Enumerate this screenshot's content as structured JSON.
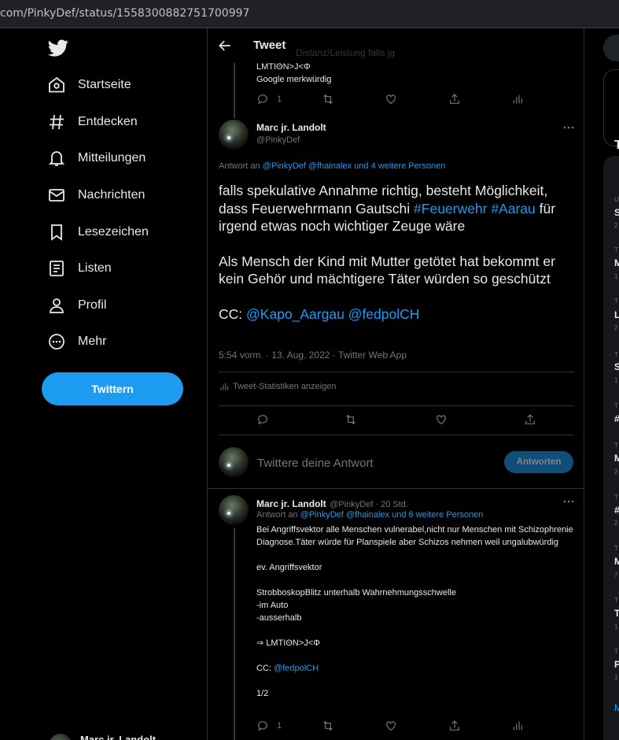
{
  "browser": {
    "url": "com/PinkyDef/status/1558300882751700997"
  },
  "nav": {
    "items": [
      {
        "label": "Startseite",
        "icon": "home-icon"
      },
      {
        "label": "Entdecken",
        "icon": "hashtag-icon"
      },
      {
        "label": "Mitteilungen",
        "icon": "bell-icon"
      },
      {
        "label": "Nachrichten",
        "icon": "mail-icon"
      },
      {
        "label": "Lesezeichen",
        "icon": "bookmark-icon"
      },
      {
        "label": "Listen",
        "icon": "list-icon"
      },
      {
        "label": "Profil",
        "icon": "person-icon"
      },
      {
        "label": "Mehr",
        "icon": "more-circle-icon"
      }
    ],
    "tweet_button": "Twittern",
    "user_name": "Marc jr. Landolt"
  },
  "header": {
    "title": "Tweet",
    "faded_text": "Distanz/Leistung falls jg"
  },
  "prev_tweet": {
    "lines": [
      "LMTIΘN>J<Φ",
      "Google merkwürdig"
    ],
    "reply_count": "1"
  },
  "main_tweet": {
    "name": "Marc jr. Landolt",
    "handle": "@PinkyDef",
    "reply_to_prefix": "Antwort an",
    "reply_to_handles": "@PinkyDef @fhainalex",
    "reply_to_more": "und 4 weitere Personen",
    "para1_a": "falls spekulative Annahme richtig, besteht Möglichkeit, dass Feuerwehrmann Gautschi",
    "hashtag1": "#Feuerwehr",
    "hashtag2": "#Aarau",
    "para1_b": "für irgend etwas noch wichtiger Zeuge wäre",
    "para2": "Als Mensch der Kind mit Mutter getötet hat bekommt er kein Gehör und mächtigere Täter würden so geschützt",
    "cc_label": "CC:",
    "cc_mentions": "@Kapo_Aargau @fedpolCH",
    "meta": "5:54 vorm. · 13. Aug. 2022 · Twitter Web App",
    "stats_label": "Tweet-Statistiken anzeigen"
  },
  "compose": {
    "placeholder": "Twittere deine Antwort",
    "button": "Antworten"
  },
  "reply_tweet": {
    "name": "Marc jr. Landolt",
    "handle_time": "@PinkyDef · 20 Std.",
    "reply_to_prefix": "Antwort an",
    "reply_to_handles": "@PinkyDef @fhainalex und 6 weitere Personen",
    "p1": "Bei Angriffsvektor alle Menschen vulnerabel,nicht nur Menschen mit Schizophrenie Diagnose.Täter würde für Planspiele aber Schizos nehmen weil ungalubwürdig",
    "p2": "ev. Angriffsvektor",
    "p3a": "StrobboskopBlitz unterhalb Wahrnehmungsschwelle",
    "p3b": "-im Auto",
    "p3c": "-ausserhalb",
    "p4": "⇒ LMTIΘN>J<Φ",
    "cc_label": "CC:",
    "cc_mention": "@fedpolCH",
    "p5": "1/2",
    "reply_count": "1"
  },
  "right": {
    "header_initial": "T",
    "trends": [
      {
        "ctx": "U",
        "title": "S",
        "count": "2"
      },
      {
        "ctx": "T",
        "title": "M",
        "count": "1"
      },
      {
        "ctx": "T",
        "title": "L",
        "count": "2"
      },
      {
        "ctx": "T",
        "title": "S",
        "count": "1"
      },
      {
        "ctx": "T",
        "title": "#",
        "count": ""
      },
      {
        "ctx": "T",
        "title": "M",
        "count": "2"
      },
      {
        "ctx": "T",
        "title": "#",
        "count": "2"
      },
      {
        "ctx": "T",
        "title": "M",
        "count": "7"
      },
      {
        "ctx": "T",
        "title": "T",
        "count": "1"
      },
      {
        "ctx": "T",
        "title": "P",
        "count": "1"
      }
    ],
    "show_more": "M"
  },
  "colors": {
    "accent": "#1d9bf0",
    "background": "#000000",
    "muted": "#71767b",
    "border": "#2f3336"
  }
}
